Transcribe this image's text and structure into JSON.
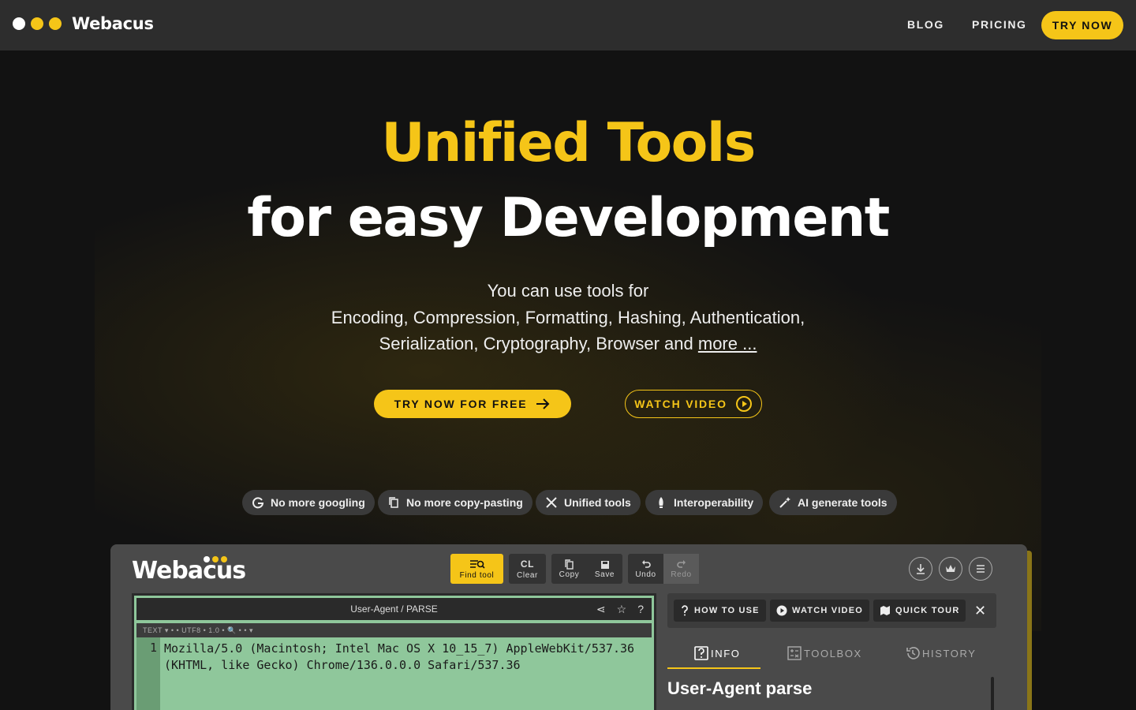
{
  "nav": {
    "brand": "Webacus",
    "links": [
      "BLOG",
      "PRICING"
    ],
    "cta": "TRY NOW"
  },
  "hero": {
    "title_line1": "Unified Tools",
    "title_line2": "for easy Development",
    "sub_line1": "You can use tools for",
    "sub_line2": "Encoding, Compression, Formatting, Hashing, Authentication,",
    "sub_line3_prefix": "Serialization, Cryptography, Browser and ",
    "sub_line3_link": "more ...",
    "cta_primary": "TRY NOW FOR FREE",
    "cta_secondary": "WATCH VIDEO"
  },
  "chips": [
    {
      "label": "No more googling",
      "icon": "google-icon"
    },
    {
      "label": "No more copy-pasting",
      "icon": "copy-icon"
    },
    {
      "label": "Unified tools",
      "icon": "tools-icon"
    },
    {
      "label": "Interoperability",
      "icon": "rocket-icon"
    },
    {
      "label": "AI generate tools",
      "icon": "magic-wand-icon"
    }
  ],
  "app": {
    "brand": "Webacus",
    "toolbar": {
      "find": "Find tool",
      "clear_icon": "CL",
      "clear": "Clear",
      "copy": "Copy",
      "save": "Save",
      "undo": "Undo",
      "redo": "Redo"
    },
    "editor": {
      "title": "User-Agent / PARSE",
      "subbar": "TEXT ▾  •  • UTF8  •  1.0  •  🔍  •  •  ▾",
      "line_number": "1",
      "code": "Mozilla/5.0 (Macintosh; Intel Mac OS X 10_15_7) AppleWebKit/537.36\n(KHTML, like Gecko) Chrome/136.0.0.0 Safari/537.36"
    },
    "side": {
      "how_to_use": "HOW TO USE",
      "watch_video": "WATCH VIDEO",
      "quick_tour": "QUICK TOUR",
      "tabs": [
        "INFO",
        "TOOLBOX",
        "HISTORY"
      ],
      "panel_title": "User-Agent parse"
    }
  },
  "colors": {
    "accent": "#f5c518",
    "background": "#121212",
    "nav": "#2d2d2d",
    "editor": "#8fc79b"
  }
}
